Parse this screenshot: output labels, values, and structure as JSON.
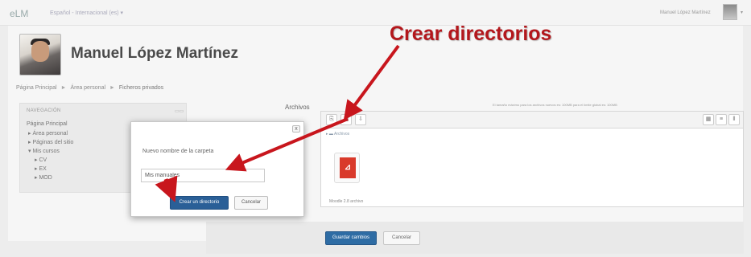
{
  "topbar": {
    "brand": "eLM",
    "language": "Español - Internacional (es) ▾",
    "user_name": "Manuel López Martínez",
    "user_caret": "▾"
  },
  "profile": {
    "full_name": "Manuel López Martínez"
  },
  "breadcrumb": {
    "items": [
      "Página Principal",
      "Área personal",
      "Ficheros privados"
    ],
    "separator": "►"
  },
  "navigation": {
    "title": "NAVEGACIÓN",
    "controls": "▭▭",
    "items": [
      {
        "label": "Página Principal"
      },
      {
        "label": "▸ Área personal"
      },
      {
        "label": "▸ Páginas del sitio"
      },
      {
        "label": "▾ Mis cursos"
      },
      {
        "label": "▸ CV"
      },
      {
        "label": "▸ EX"
      },
      {
        "label": "▸ MOD"
      }
    ]
  },
  "files": {
    "label": "Archivos",
    "max_size_note": "El tamaño máximo para los archivos nuevos es: 100MB para el límite global es: 100MB",
    "path": "▸ ▬ Archivos",
    "file_name": "Moodle 2.8 archivo",
    "file_icon_text": "⊿"
  },
  "toolbar": {
    "add_file_icon": "⎘",
    "create_folder_icon": "▦",
    "download_icon": "⇩",
    "view_icons_icon": "▦",
    "view_details_icon": "≡",
    "view_tree_icon": "⫴"
  },
  "footer": {
    "save_label": "Guardar cambios",
    "cancel_label": "Cancelar"
  },
  "dialog": {
    "close_label": "x",
    "folder_name_label": "Nuevo nombre de la carpeta",
    "folder_name_value": "Mis manuales",
    "create_label": "Crear un directorio",
    "cancel_label": "Cancelar"
  },
  "annotation": {
    "text": "Crear directorios",
    "color": "#b3171c"
  },
  "colors": {
    "primary_button": "#2e6ca4",
    "dialog_primary_button": "#2a5f97",
    "pdf_red": "#d93a2b"
  }
}
